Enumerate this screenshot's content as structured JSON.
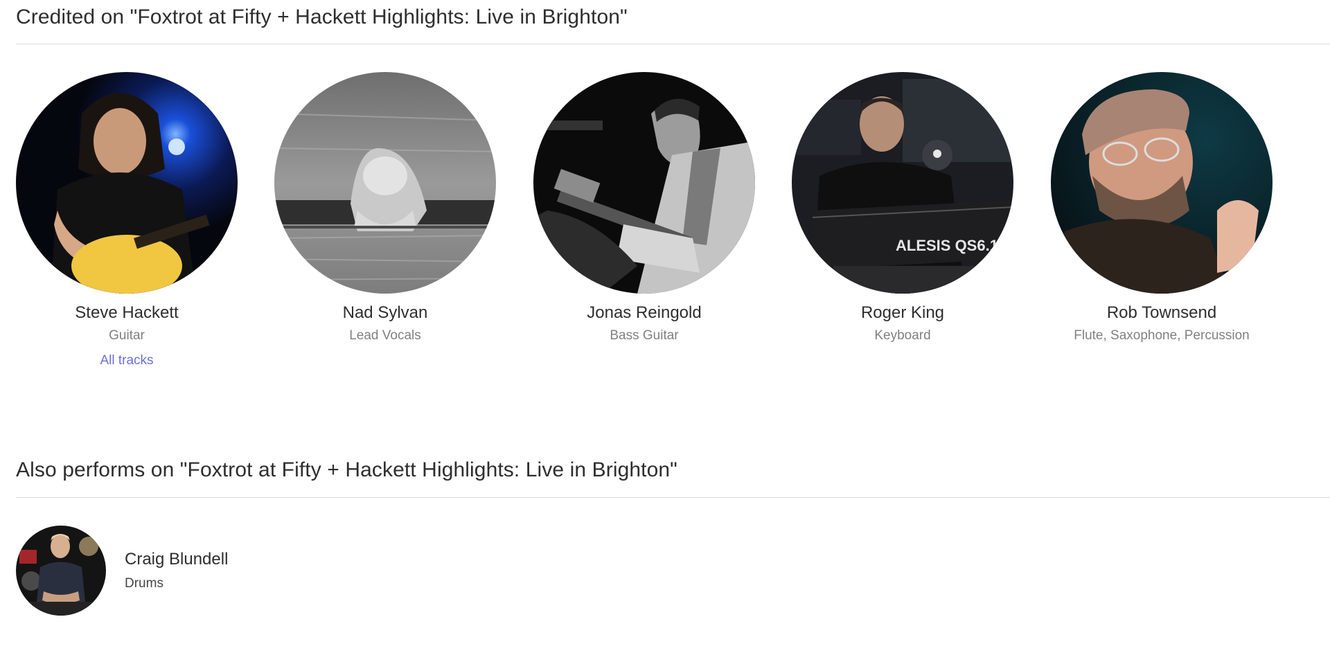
{
  "credited_section": {
    "title": "Credited on \"Foxtrot at Fifty + Hackett Highlights: Live in Brighton\"",
    "artists": [
      {
        "name": "Steve Hackett",
        "role": "Guitar",
        "link": "All tracks"
      },
      {
        "name": "Nad Sylvan",
        "role": "Lead Vocals"
      },
      {
        "name": "Jonas Reingold",
        "role": "Bass Guitar"
      },
      {
        "name": "Roger King",
        "role": "Keyboard"
      },
      {
        "name": "Rob Townsend",
        "role": "Flute, Saxophone, Percussion"
      }
    ]
  },
  "also_section": {
    "title": "Also performs on \"Foxtrot at Fifty + Hackett Highlights: Live in Brighton\"",
    "performers": [
      {
        "name": "Craig Blundell",
        "role": "Drums"
      }
    ]
  },
  "photo_text": {
    "keyboard_brand": "ALESIS QS6.1"
  },
  "colors": {
    "link": "#6c6fd6",
    "divider": "#dcdcdc",
    "muted_text": "#808080"
  }
}
